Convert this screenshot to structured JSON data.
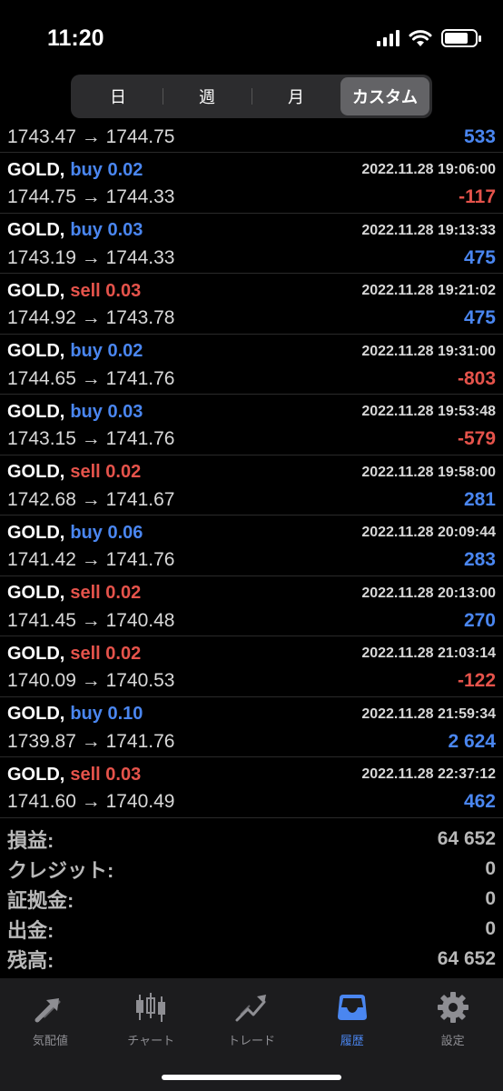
{
  "status_bar": {
    "time": "11:20"
  },
  "period_tabs": [
    {
      "label": "日",
      "active": false
    },
    {
      "label": "週",
      "active": false
    },
    {
      "label": "月",
      "active": false
    },
    {
      "label": "カスタム",
      "active": true
    }
  ],
  "first_partial": {
    "prices": "1743.47 → 1744.75",
    "profit": "533"
  },
  "trades": [
    {
      "symbol": "GOLD,",
      "side": "buy 0.02",
      "type": "buy",
      "time": "2022.11.28 19:06:00",
      "prices": "1744.75 → 1744.33",
      "profit": "-117",
      "sign": "neg"
    },
    {
      "symbol": "GOLD,",
      "side": "buy 0.03",
      "type": "buy",
      "time": "2022.11.28 19:13:33",
      "prices": "1743.19 → 1744.33",
      "profit": "475",
      "sign": "pos"
    },
    {
      "symbol": "GOLD,",
      "side": "sell 0.03",
      "type": "sell",
      "time": "2022.11.28 19:21:02",
      "prices": "1744.92 → 1743.78",
      "profit": "475",
      "sign": "pos"
    },
    {
      "symbol": "GOLD,",
      "side": "buy 0.02",
      "type": "buy",
      "time": "2022.11.28 19:31:00",
      "prices": "1744.65 → 1741.76",
      "profit": "-803",
      "sign": "neg"
    },
    {
      "symbol": "GOLD,",
      "side": "buy 0.03",
      "type": "buy",
      "time": "2022.11.28 19:53:48",
      "prices": "1743.15 → 1741.76",
      "profit": "-579",
      "sign": "neg"
    },
    {
      "symbol": "GOLD,",
      "side": "sell 0.02",
      "type": "sell",
      "time": "2022.11.28 19:58:00",
      "prices": "1742.68 → 1741.67",
      "profit": "281",
      "sign": "pos"
    },
    {
      "symbol": "GOLD,",
      "side": "buy 0.06",
      "type": "buy",
      "time": "2022.11.28 20:09:44",
      "prices": "1741.42 → 1741.76",
      "profit": "283",
      "sign": "pos"
    },
    {
      "symbol": "GOLD,",
      "side": "sell 0.02",
      "type": "sell",
      "time": "2022.11.28 20:13:00",
      "prices": "1741.45 → 1740.48",
      "profit": "270",
      "sign": "pos"
    },
    {
      "symbol": "GOLD,",
      "side": "sell 0.02",
      "type": "sell",
      "time": "2022.11.28 21:03:14",
      "prices": "1740.09 → 1740.53",
      "profit": "-122",
      "sign": "neg"
    },
    {
      "symbol": "GOLD,",
      "side": "buy 0.10",
      "type": "buy",
      "time": "2022.11.28 21:59:34",
      "prices": "1739.87 → 1741.76",
      "profit": "2 624",
      "sign": "pos"
    },
    {
      "symbol": "GOLD,",
      "side": "sell 0.03",
      "type": "sell",
      "time": "2022.11.28 22:37:12",
      "prices": "1741.60 → 1740.49",
      "profit": "462",
      "sign": "pos"
    }
  ],
  "summary": [
    {
      "label": "損益:",
      "value": "64 652"
    },
    {
      "label": "クレジット:",
      "value": "0"
    },
    {
      "label": "証拠金:",
      "value": "0"
    },
    {
      "label": "出金:",
      "value": "0"
    },
    {
      "label": "残高:",
      "value": "64 652"
    }
  ],
  "tabbar": [
    {
      "label": "気配値",
      "icon": "quotes-arrows-icon",
      "active": false
    },
    {
      "label": "チャート",
      "icon": "candlestick-chart-icon",
      "active": false
    },
    {
      "label": "トレード",
      "icon": "trade-line-icon",
      "active": false
    },
    {
      "label": "履歴",
      "icon": "history-inbox-icon",
      "active": true
    },
    {
      "label": "設定",
      "icon": "gear-icon",
      "active": false
    }
  ],
  "colors": {
    "buy": "#4a86f0",
    "sell": "#e5534b",
    "active_tab": "#4a86f0"
  }
}
